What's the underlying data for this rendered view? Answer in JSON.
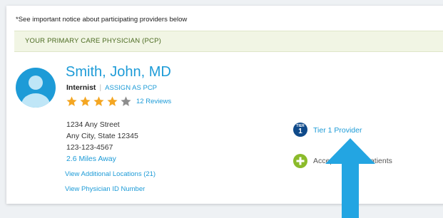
{
  "notice": "*See important notice about participating providers below",
  "pcp_bar": "YOUR PRIMARY CARE PHYSICIAN (PCP)",
  "physician": {
    "name": "Smith, John, MD",
    "specialty": "Internist",
    "assign_label": "ASSIGN AS PCP",
    "rating_stars": 4,
    "rating_max": 5,
    "reviews": "12 Reviews",
    "address_line1": "1234 Any Street",
    "address_line2": "Any City, State  12345",
    "phone": "123-123-4567",
    "distance": "2.6 Miles Away",
    "additional_locations": "View Additional Locations (21)",
    "physician_id_link": "View Physician ID Number"
  },
  "tier": {
    "badge_small": "TIER",
    "badge_number": "1",
    "label": "Tier 1 Provider"
  },
  "accepting": {
    "label": "Accepting New Patients"
  },
  "colors": {
    "accent": "#1d9bd7",
    "star_filled": "#f4a622",
    "star_empty": "#8d8d8d",
    "tier_badge": "#0f4a8a",
    "plus_badge": "#8bbb2b",
    "pcp_bar_bg": "#f1f5e4"
  }
}
